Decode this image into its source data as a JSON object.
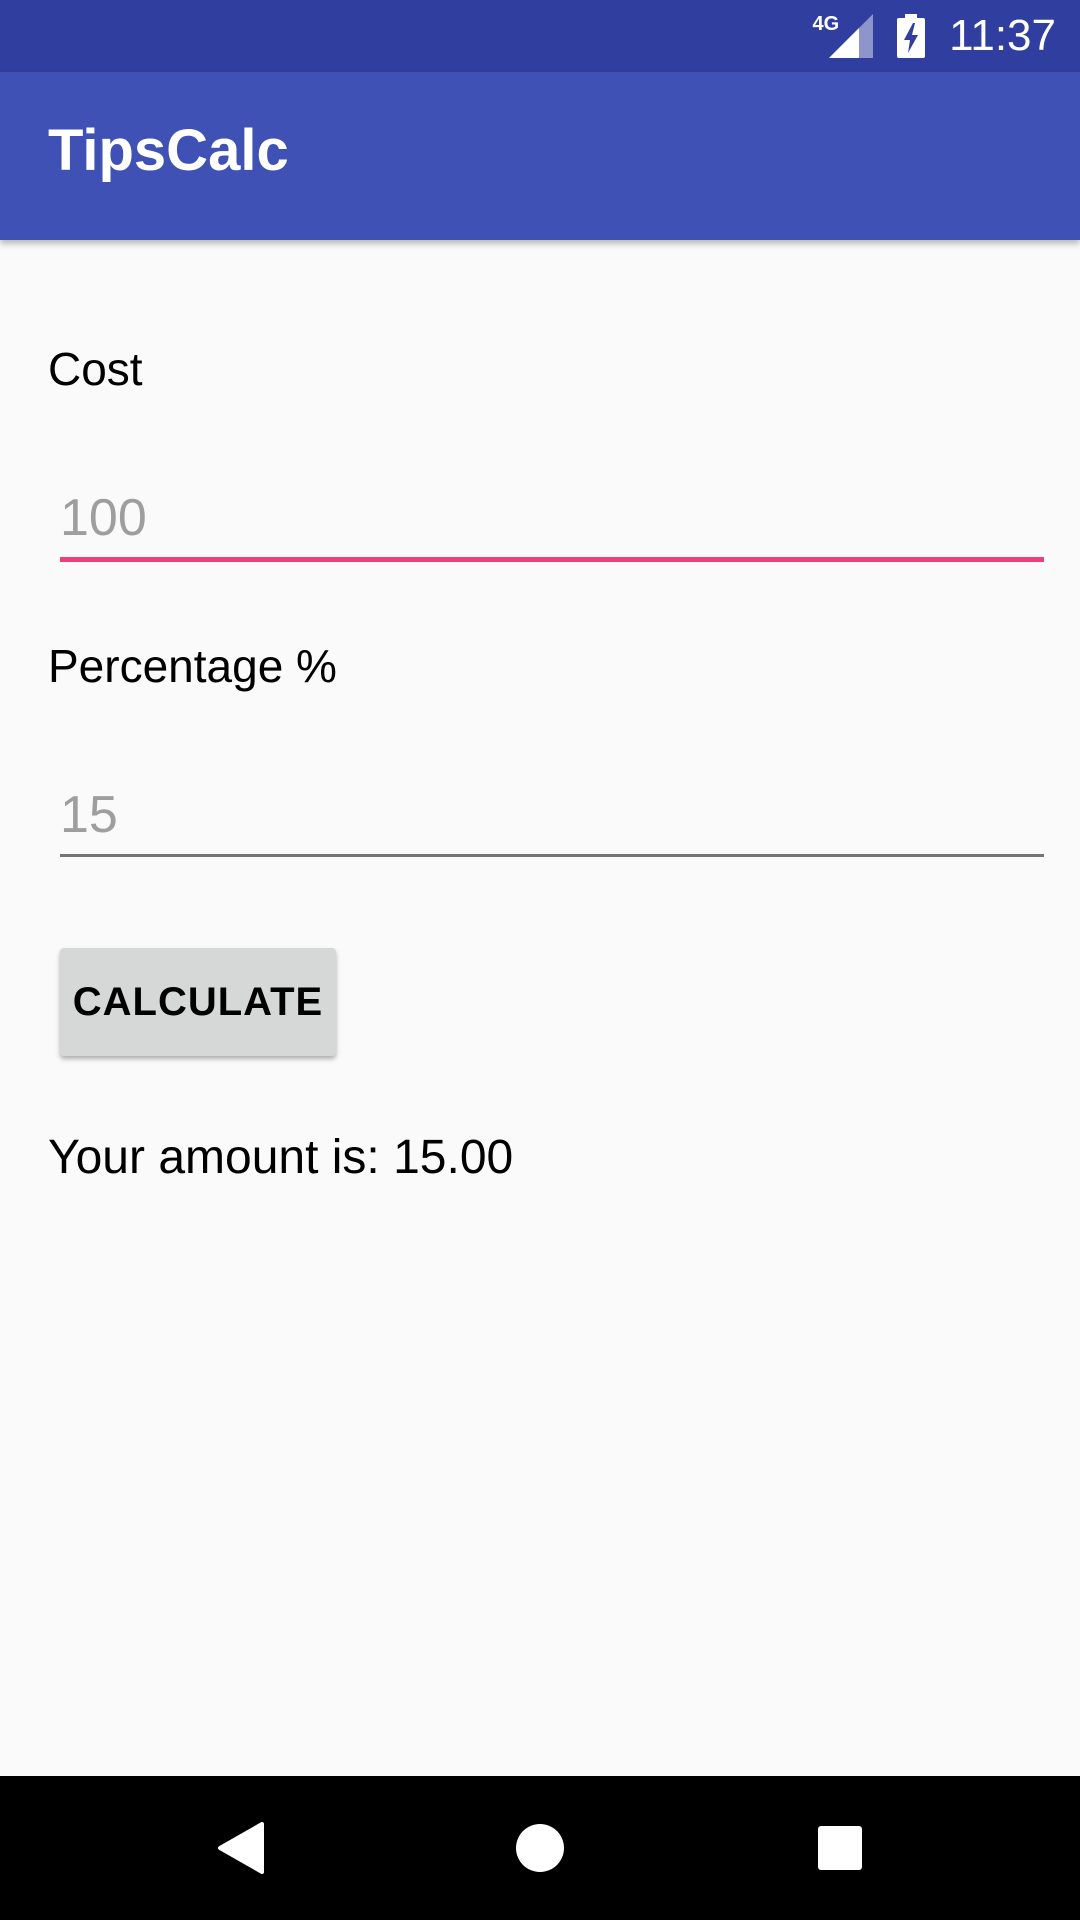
{
  "status_bar": {
    "network_type": "4G",
    "time": "11:37",
    "icons": [
      "signal-icon",
      "battery-charging-icon"
    ]
  },
  "app_bar": {
    "title": "TipsCalc"
  },
  "form": {
    "cost_label": "Cost",
    "cost_placeholder": "100",
    "percentage_label": "Percentage %",
    "percentage_placeholder": "15",
    "calculate_label": "CALCULATE",
    "result_text": "Your amount is: 15.00"
  },
  "nav_bar": {
    "icons": [
      "back-icon",
      "home-icon",
      "recents-icon"
    ]
  },
  "colors": {
    "status_bar": "#303f9f",
    "app_bar": "#3f51b5",
    "focus_underline": "#ec407a",
    "background": "#fafafa",
    "button": "#d6d7d7"
  }
}
